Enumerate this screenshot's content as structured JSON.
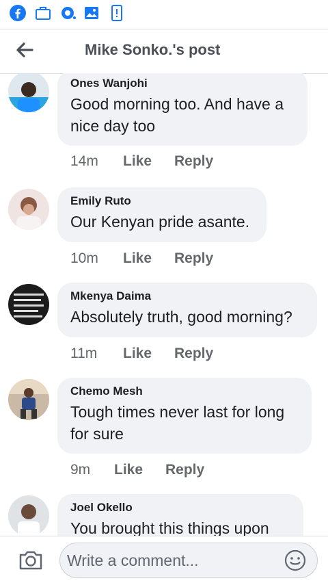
{
  "status_bar": {
    "icons": [
      "facebook-icon",
      "briefcase-icon",
      "sync-icon",
      "gallery-icon",
      "phone-alert-icon"
    ],
    "accent_color": "#1877f2"
  },
  "header": {
    "title": "Mike Sonko.'s post",
    "back_icon": "back-arrow-icon"
  },
  "comments": [
    {
      "author": "Ones Wanjohi",
      "text": "Good morning too. And have a nice day too",
      "time": "14m",
      "like_label": "Like",
      "reply_label": "Reply"
    },
    {
      "author": "Emily Ruto",
      "text": "Our Kenyan pride asante.",
      "time": "10m",
      "like_label": "Like",
      "reply_label": "Reply"
    },
    {
      "author": "Mkenya Daima",
      "text": "Absolutely truth, good morning?",
      "time": "11m",
      "like_label": "Like",
      "reply_label": "Reply"
    },
    {
      "author": "Chemo Mesh",
      "text": "Tough times never last for long for sure",
      "time": "9m",
      "like_label": "Like",
      "reply_label": "Reply"
    },
    {
      "author": "Joel Okello",
      "text": "You brought this things upon"
    }
  ],
  "composer": {
    "placeholder": "Write a comment...",
    "camera_icon": "camera-icon",
    "emoji_icon": "smiley-icon"
  }
}
